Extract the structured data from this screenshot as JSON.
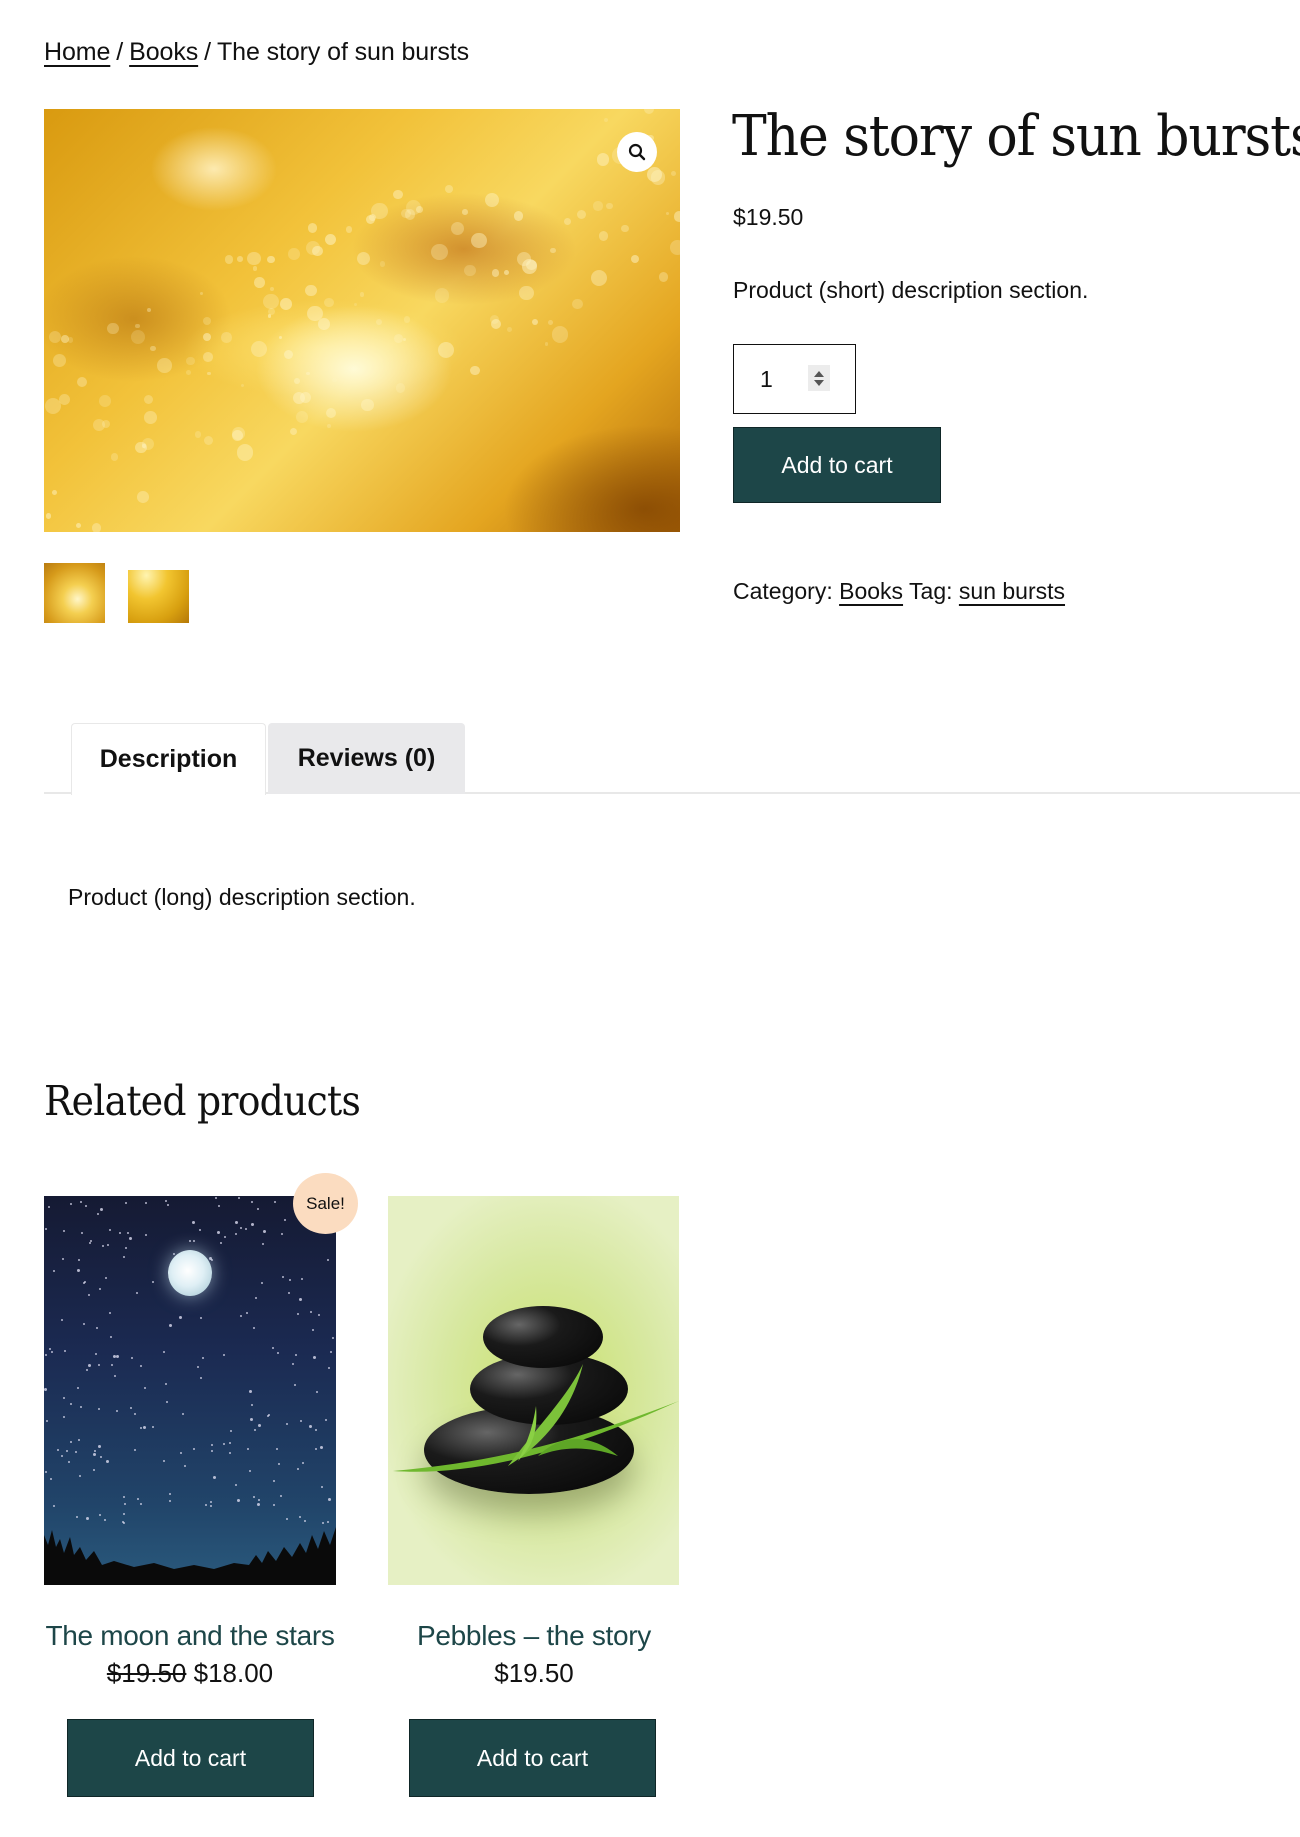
{
  "breadcrumb": {
    "items": [
      {
        "label": "Home",
        "link": true
      },
      {
        "label": "Books",
        "link": true
      },
      {
        "label": "The story of sun bursts",
        "link": false
      }
    ],
    "separator": "/"
  },
  "product": {
    "title": "The story of sun bursts",
    "price": "$19.50",
    "short_description": "Product (short) description section.",
    "quantity": "1",
    "add_to_cart_label": "Add to cart",
    "category_label": "Category:",
    "category": "Books",
    "tag_label": "Tag:",
    "tag": "sun bursts",
    "gallery": {
      "main_image": "golden-bokeh-image",
      "thumbnails": [
        "golden-bokeh-thumb-1",
        "golden-glow-thumb-2"
      ],
      "zoom_icon": "magnifier-icon"
    }
  },
  "tabs": {
    "items": [
      {
        "label": "Description",
        "active": true
      },
      {
        "label": "Reviews (0)",
        "active": false
      }
    ],
    "description_content": "Product (long) description section."
  },
  "related": {
    "heading": "Related products",
    "products": [
      {
        "title": "The moon and the stars",
        "image": "night-sky-moon-image",
        "sale_badge": "Sale!",
        "regular_price": "$19.50",
        "sale_price": "$18.00",
        "add_to_cart_label": "Add to cart"
      },
      {
        "title": "Pebbles – the story",
        "image": "black-pebbles-image",
        "price": "$19.50",
        "add_to_cart_label": "Add to cart"
      }
    ]
  },
  "colors": {
    "button_bg": "#1d4648",
    "link_title": "#1d4648",
    "sale_badge_bg": "#fbdcc0",
    "tab_inactive_bg": "#e9e9eb"
  }
}
